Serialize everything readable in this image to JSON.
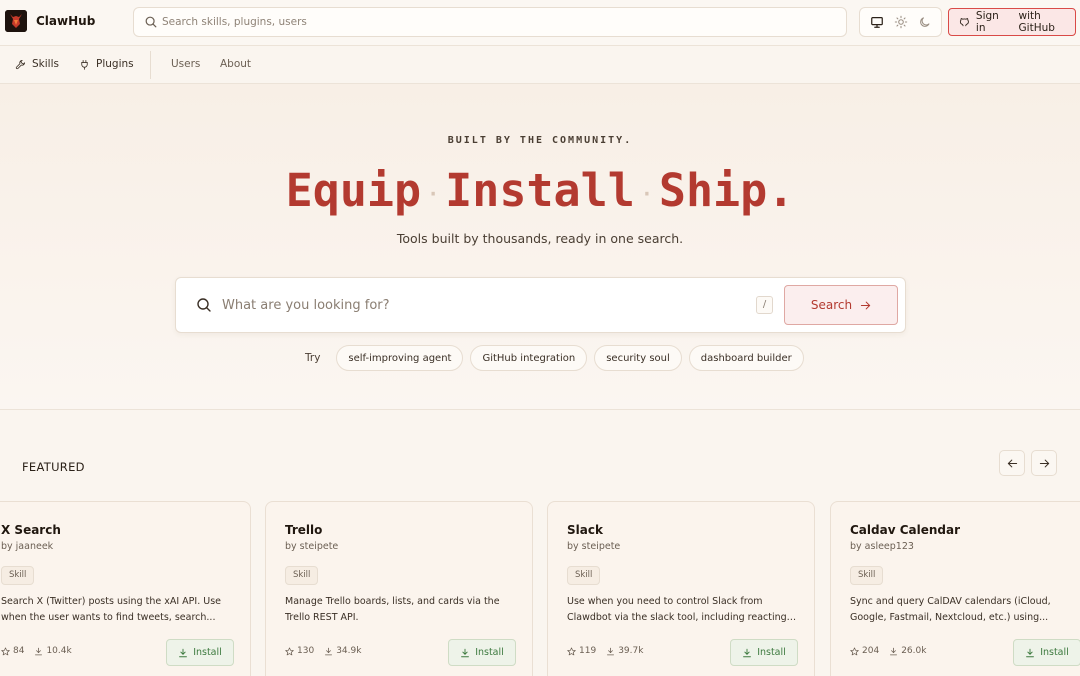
{
  "header": {
    "brand": "ClawHub",
    "search_placeholder": "Search skills, plugins, users",
    "theme_options": [
      "monitor-icon",
      "sun-icon",
      "moon-icon"
    ],
    "signin_label": "Sign in",
    "signin_suffix": "with GitHub"
  },
  "nav": {
    "items": [
      {
        "label": "Skills",
        "icon": "wrench-icon"
      },
      {
        "label": "Plugins",
        "icon": "plug-icon"
      },
      {
        "label": "Users"
      },
      {
        "label": "About"
      }
    ]
  },
  "hero": {
    "eyebrow": "BUILT BY THE COMMUNITY.",
    "headline_words": [
      "Equip",
      "Install",
      "Ship."
    ],
    "subtitle": "Tools built by thousands, ready in one search.",
    "search_placeholder": "What are you looking for?",
    "shortcut": "/",
    "search_button": "Search",
    "try_label": "Try",
    "suggestions": [
      "self-improving agent",
      "GitHub integration",
      "security soul",
      "dashboard builder"
    ]
  },
  "featured": {
    "label": "FEATURED",
    "cards": [
      {
        "title": "X Search",
        "author": "by jaaneek",
        "tag": "Skill",
        "description": "Search X (Twitter) posts using the xAI API. Use when the user wants to find tweets, search...",
        "stars": "84",
        "downloads": "10.4k",
        "install": "Install"
      },
      {
        "title": "Trello",
        "author": "by steipete",
        "tag": "Skill",
        "description": "Manage Trello boards, lists, and cards via the Trello REST API.",
        "stars": "130",
        "downloads": "34.9k",
        "install": "Install"
      },
      {
        "title": "Slack",
        "author": "by steipete",
        "tag": "Skill",
        "description": "Use when you need to control Slack from Clawdbot via the slack tool, including reacting to...",
        "stars": "119",
        "downloads": "39.7k",
        "install": "Install"
      },
      {
        "title": "Caldav Calendar",
        "author": "by asleep123",
        "tag": "Skill",
        "description": "Sync and query CalDAV calendars (iCloud, Google, Fastmail, Nextcloud, etc.) using...",
        "stars": "204",
        "downloads": "26.0k",
        "install": "Install"
      }
    ]
  },
  "colors": {
    "accent": "#b33a30",
    "background": "#faf5ef",
    "install_green": "#3d7a3f"
  }
}
